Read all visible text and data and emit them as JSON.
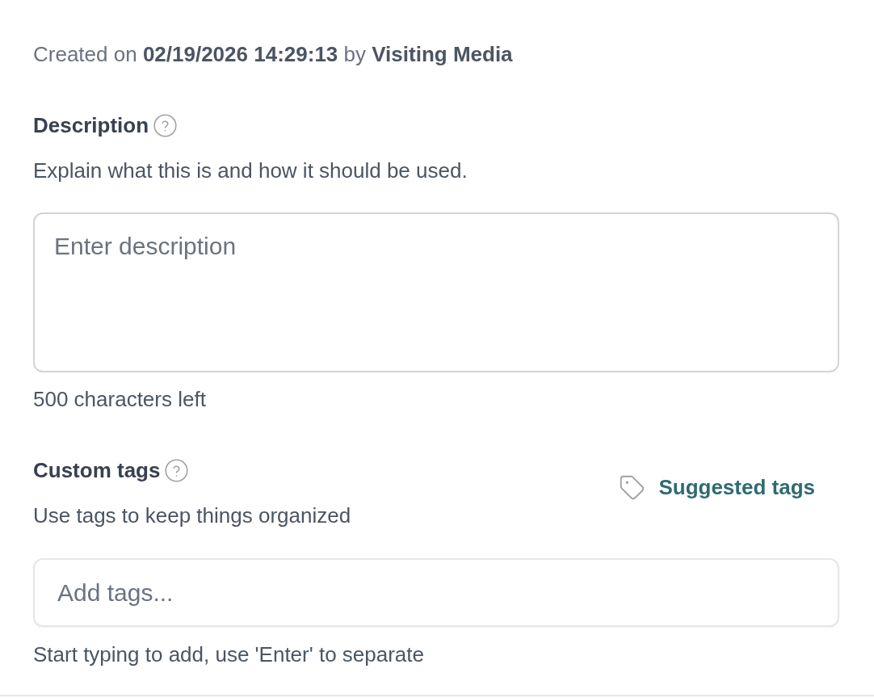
{
  "created_info": "Created on **02/19/2026 14:29:13** by **Visiting Media**",
  "description": {
    "label": "Description",
    "hint": "Explain what this is and how it should be used.",
    "field": {
      "placeholder": "Enter description"
    },
    "counter": "500 characters left"
  },
  "custom_tags": {
    "label": "Custom tags",
    "hint": "Use tags to keep things organized",
    "suggested_tags": "Suggested tags",
    "field": {
      "placeholder": "Add tags..."
    },
    "helper": "Start typing to add, use 'Enter' to separate"
  }
}
